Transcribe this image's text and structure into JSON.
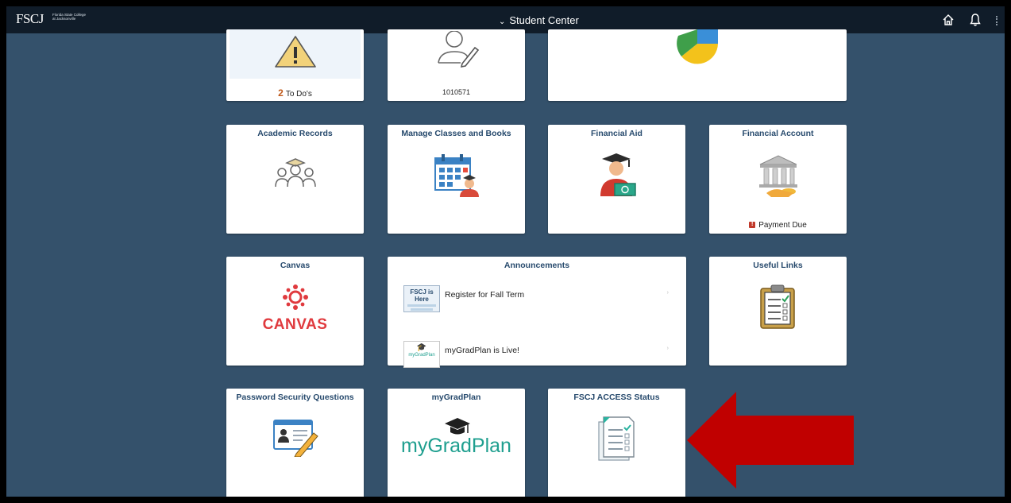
{
  "header": {
    "logo_text": "FSCJ",
    "logo_subtext": "Florida State College at Jacksonville",
    "title": "Student Center",
    "icons": [
      "chevron-down-icon",
      "home-icon",
      "bell-icon",
      "kebab-menu-icon"
    ]
  },
  "tiles": {
    "todos": {
      "count": "2",
      "label": "To Do's",
      "icon": "warning-icon"
    },
    "profile": {
      "id": "1010571",
      "icon": "user-edit-icon"
    },
    "chart_tile": {
      "icon": "pie-chart-icon"
    },
    "academic_records": {
      "title": "Academic Records",
      "icon": "graduates-icon"
    },
    "manage_classes": {
      "title": "Manage Classes and Books",
      "icon": "calendar-student-icon"
    },
    "financial_aid": {
      "title": "Financial Aid",
      "icon": "student-money-icon"
    },
    "financial_account": {
      "title": "Financial Account",
      "status": "Payment Due",
      "icon": "bank-icon",
      "status_color": "#c0392b"
    },
    "canvas": {
      "title": "Canvas",
      "logo_text": "CANVAS",
      "icon": "canvas-logo-icon",
      "brand_color": "#e03a3e"
    },
    "announcements": {
      "title": "Announcements",
      "items": [
        {
          "thumb": "FSCJ is Here",
          "text": "Register for Fall Term"
        },
        {
          "thumb": "myGradPlan",
          "text": "myGradPlan is Live!"
        }
      ]
    },
    "useful_links": {
      "title": "Useful Links",
      "icon": "clipboard-checklist-icon"
    },
    "password_security": {
      "title": "Password Security Questions",
      "icon": "id-card-pencil-icon"
    },
    "mygradplan": {
      "title": "myGradPlan",
      "logo_text": "myGradPlan",
      "icon": "grad-cap-icon",
      "brand_color": "#1f9f8f"
    },
    "access_status": {
      "title": "FSCJ ACCESS Status",
      "icon": "document-checklist-icon"
    }
  },
  "annotation": {
    "icon": "red-arrow-icon",
    "color": "#c00000"
  }
}
